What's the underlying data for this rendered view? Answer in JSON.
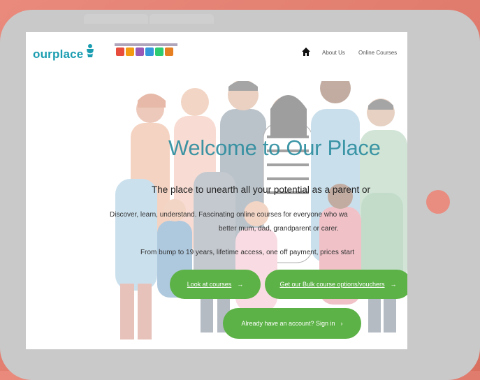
{
  "header": {
    "logo_text": "ourplace",
    "nav": [
      {
        "label": "About Us"
      },
      {
        "label": "Online Courses"
      }
    ],
    "home_icon": "home-icon",
    "partner_logo_colors": [
      "#e74c3c",
      "#f39c12",
      "#9b59b6",
      "#3498db",
      "#2ecc71",
      "#e67e22"
    ]
  },
  "hero": {
    "title": "Welcome to Our Place",
    "subtitle": "The place to unearth all your potential as a parent or",
    "desc_line1": "Discover, learn, understand. Fascinating online courses for everyone who wa",
    "desc_line2": "better mum, dad, grandparent or carer.",
    "desc_line3": "From bump to 19 years, lifetime access, one off payment, prices start"
  },
  "buttons": {
    "cta1": "Look at courses",
    "cta2": "Get our Bulk course options/vouchers",
    "cta3": "Already have an account? Sign in"
  },
  "colors": {
    "brand_teal": "#1b9db1",
    "cta_green": "#5cb246",
    "device_frame": "#c9c9c9",
    "background": "#e07c6e"
  }
}
